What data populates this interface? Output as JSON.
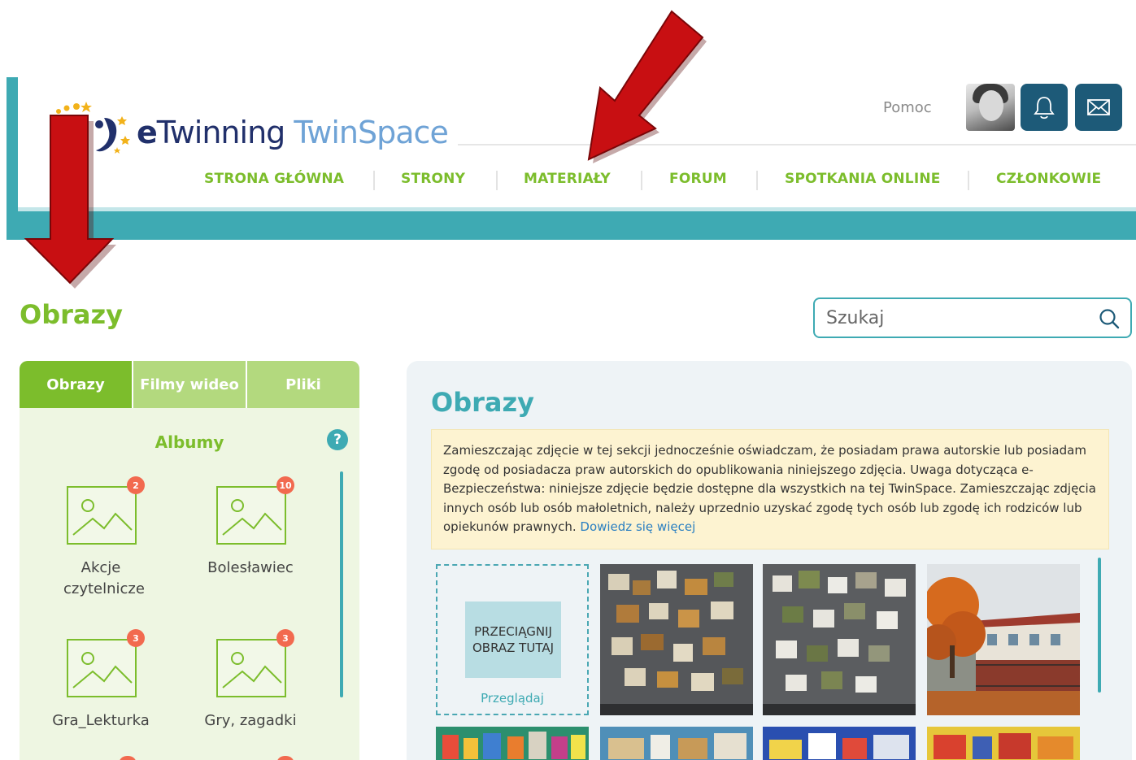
{
  "logo": {
    "e": "e",
    "twinning": "Twinning",
    "twinspace": "TwinSpace"
  },
  "header": {
    "help_label": "Pomoc",
    "avatar_icon": "user-photo",
    "notifications_icon": "bell-icon",
    "messages_icon": "envelope-icon"
  },
  "nav": {
    "items": [
      {
        "label": "STRONA GŁÓWNA"
      },
      {
        "label": "STRONY"
      },
      {
        "label": "MATERIAŁY"
      },
      {
        "label": "FORUM"
      },
      {
        "label": "SPOTKANIA ONLINE"
      },
      {
        "label": "CZŁONKOWIE"
      }
    ]
  },
  "page": {
    "title": "Obrazy"
  },
  "search": {
    "placeholder": "Szukaj"
  },
  "left_panel": {
    "tabs": [
      {
        "label": "Obrazy"
      },
      {
        "label": "Filmy wideo"
      },
      {
        "label": "Pliki"
      }
    ],
    "albums_title": "Albumy",
    "help_glyph": "?",
    "albums": [
      {
        "label": "Akcje czytelnicze",
        "count": "2"
      },
      {
        "label": "Bolesławiec",
        "count": "10"
      },
      {
        "label": "Gra_Lekturka",
        "count": "3"
      },
      {
        "label": "Gry, zagadki",
        "count": "3"
      }
    ]
  },
  "right_panel": {
    "title": "Obrazy",
    "notice": "Zamieszczając zdjęcie w tej sekcji jednocześnie oświadczam, że posiadam prawa autorskie lub posiadam zgodę od posiadacza praw autorskich do opublikowania niniejszego zdjęcia. Uwaga dotycząca e-Bezpieczeństwa: niniejsze zdjęcie będzie dostępne dla wszystkich na tej TwinSpace. Zamieszczając zdjęcia innych osób lub osób małoletnich, należy uprzednio uzyskać zgodę tych osób lub zgodę ich rodziców lub opiekunów prawnych.",
    "notice_link": "Dowiedz się więcej",
    "drop_text_line1": "PRZECIĄGNIJ",
    "drop_text_line2": "OBRAZ TUTAJ",
    "browse_label": "Przeglądaj"
  },
  "colors": {
    "green": "#7cbd2c",
    "teal": "#3eaab3",
    "navy": "#1d5a78",
    "badge": "#f26a4f",
    "notice_bg": "#fdf3d1",
    "arrow": "#c80f12"
  }
}
